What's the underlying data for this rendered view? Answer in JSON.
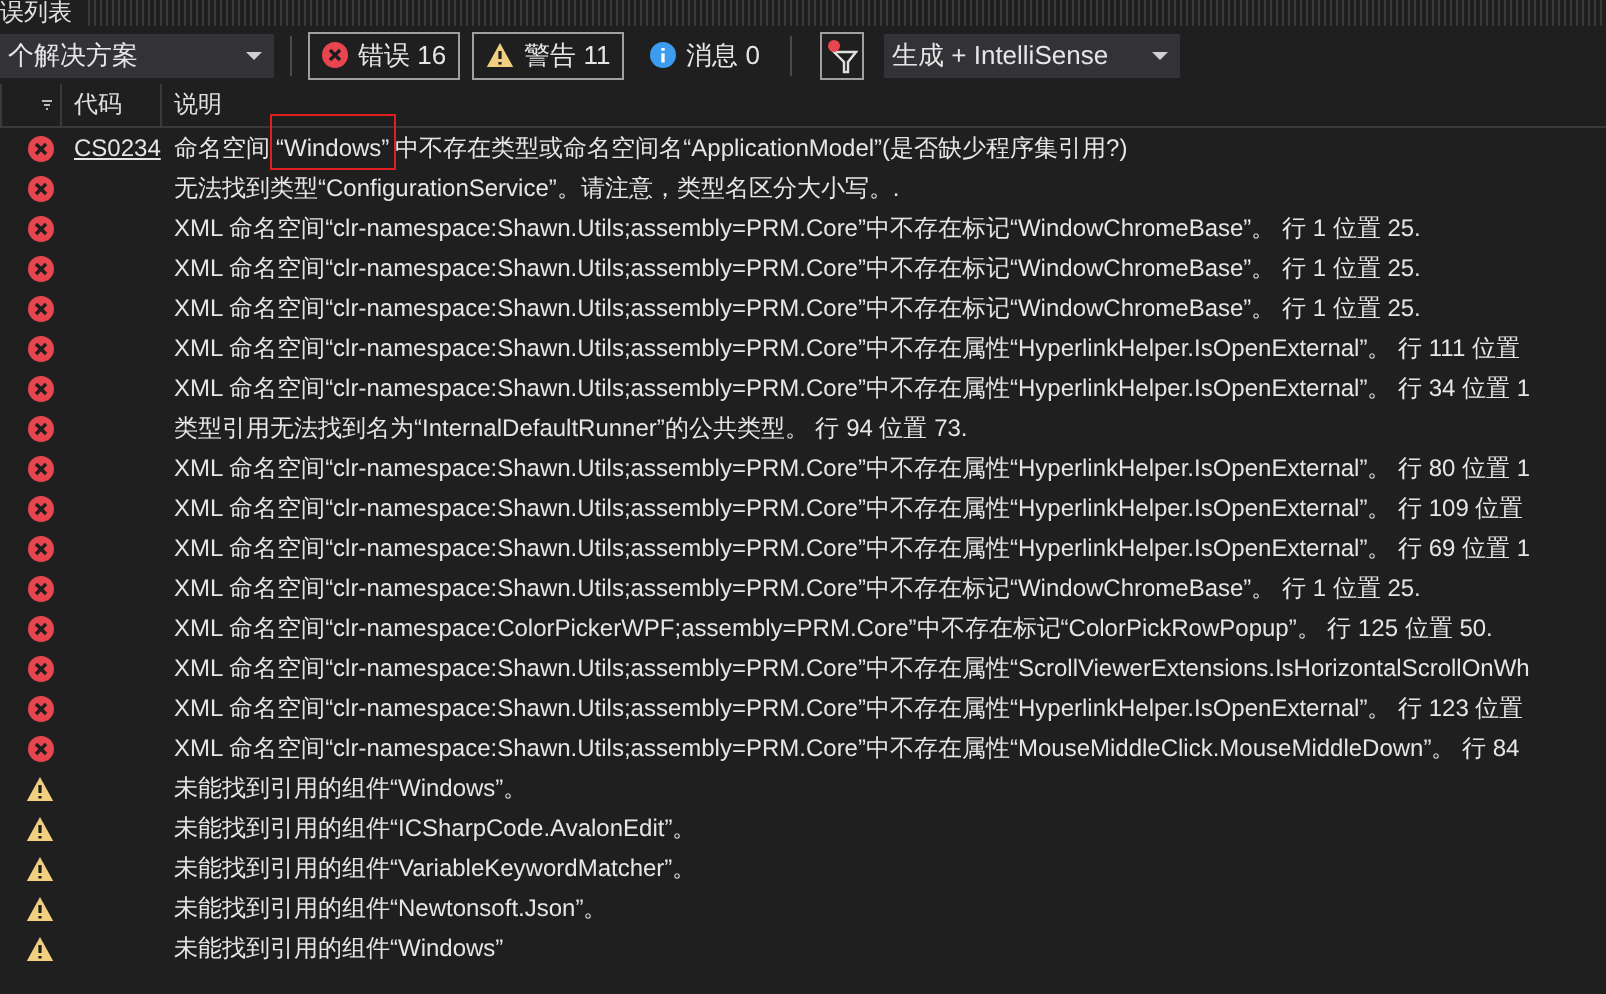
{
  "panel": {
    "title": "误列表"
  },
  "toolbar": {
    "scope": "个解决方案",
    "filters": [
      {
        "kind": "error",
        "label": "错误 16",
        "selected": true
      },
      {
        "kind": "warning",
        "label": "警告 11",
        "selected": true
      },
      {
        "kind": "info",
        "label": "消息 0",
        "selected": false
      }
    ],
    "source": "生成 + IntelliSense"
  },
  "table": {
    "columns": [
      "代码",
      "说明"
    ],
    "rows": [
      {
        "kind": "error",
        "code": "CS0234",
        "segments": [
          {
            "text": "命名空间",
            "annotated": false
          },
          {
            "text": "“Windows”",
            "annotated": true
          },
          {
            "text": "中不存在类型或命名空间名“ApplicationModel”(是否缺少程序集引用?)",
            "annotated": false
          }
        ]
      },
      {
        "kind": "error",
        "description": "无法找到类型“ConfigurationService”。请注意，类型名区分大小写。."
      },
      {
        "kind": "error",
        "description": "XML 命名空间“clr-namespace:Shawn.Utils;assembly=PRM.Core”中不存在标记“WindowChromeBase”。 行 1 位置 25."
      },
      {
        "kind": "error",
        "description": "XML 命名空间“clr-namespace:Shawn.Utils;assembly=PRM.Core”中不存在标记“WindowChromeBase”。 行 1 位置 25."
      },
      {
        "kind": "error",
        "description": "XML 命名空间“clr-namespace:Shawn.Utils;assembly=PRM.Core”中不存在标记“WindowChromeBase”。 行 1 位置 25."
      },
      {
        "kind": "error",
        "description": "XML 命名空间“clr-namespace:Shawn.Utils;assembly=PRM.Core”中不存在属性“HyperlinkHelper.IsOpenExternal”。 行 111 位置"
      },
      {
        "kind": "error",
        "description": "XML 命名空间“clr-namespace:Shawn.Utils;assembly=PRM.Core”中不存在属性“HyperlinkHelper.IsOpenExternal”。 行 34 位置 1"
      },
      {
        "kind": "error",
        "description": "类型引用无法找到名为“InternalDefaultRunner”的公共类型。 行 94 位置 73."
      },
      {
        "kind": "error",
        "description": "XML 命名空间“clr-namespace:Shawn.Utils;assembly=PRM.Core”中不存在属性“HyperlinkHelper.IsOpenExternal”。 行 80 位置 1"
      },
      {
        "kind": "error",
        "description": "XML 命名空间“clr-namespace:Shawn.Utils;assembly=PRM.Core”中不存在属性“HyperlinkHelper.IsOpenExternal”。 行 109 位置"
      },
      {
        "kind": "error",
        "description": "XML 命名空间“clr-namespace:Shawn.Utils;assembly=PRM.Core”中不存在属性“HyperlinkHelper.IsOpenExternal”。 行 69 位置 1"
      },
      {
        "kind": "error",
        "description": "XML 命名空间“clr-namespace:Shawn.Utils;assembly=PRM.Core”中不存在标记“WindowChromeBase”。 行 1 位置 25."
      },
      {
        "kind": "error",
        "description": "XML 命名空间“clr-namespace:ColorPickerWPF;assembly=PRM.Core”中不存在标记“ColorPickRowPopup”。 行 125 位置 50."
      },
      {
        "kind": "error",
        "description": "XML 命名空间“clr-namespace:Shawn.Utils;assembly=PRM.Core”中不存在属性“ScrollViewerExtensions.IsHorizontalScrollOnWh"
      },
      {
        "kind": "error",
        "description": "XML 命名空间“clr-namespace:Shawn.Utils;assembly=PRM.Core”中不存在属性“HyperlinkHelper.IsOpenExternal”。 行 123 位置"
      },
      {
        "kind": "error",
        "description": "XML 命名空间“clr-namespace:Shawn.Utils;assembly=PRM.Core”中不存在属性“MouseMiddleClick.MouseMiddleDown”。 行 84"
      },
      {
        "kind": "warning",
        "description": "未能找到引用的组件“Windows”。"
      },
      {
        "kind": "warning",
        "description": "未能找到引用的组件“ICSharpCode.AvalonEdit”。"
      },
      {
        "kind": "warning",
        "description": "未能找到引用的组件“VariableKeywordMatcher”。"
      },
      {
        "kind": "warning",
        "description": "未能找到引用的组件“Newtonsoft.Json”。"
      },
      {
        "kind": "warning",
        "description": "未能找到引用的组件“Windows”"
      }
    ]
  }
}
